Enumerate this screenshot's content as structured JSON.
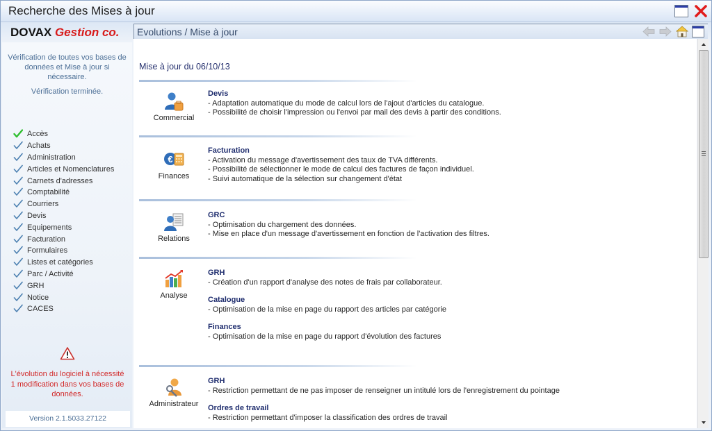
{
  "window": {
    "title": "Recherche des Mises à jour",
    "restore_icon": "window-restore-icon",
    "close_icon": "close-x-icon"
  },
  "brand": {
    "name": "DOVAX",
    "tagline": "Gestion co."
  },
  "header": {
    "breadcrumb": "Evolutions / Mise à jour",
    "icons": [
      "back-arrow-icon",
      "forward-arrow-icon",
      "home-icon",
      "window-icon"
    ]
  },
  "sidebar": {
    "info": "Vérification de toutes vos bases de données et Mise à jour si nécessaire.",
    "status": "Vérification terminée.",
    "checks": [
      {
        "label": "Accès",
        "state": "current",
        "color": "#2fbf2f"
      },
      {
        "label": "Achats",
        "state": "done",
        "color": "#4a7fb0"
      },
      {
        "label": "Administration",
        "state": "done",
        "color": "#4a7fb0"
      },
      {
        "label": "Articles et Nomenclatures",
        "state": "done",
        "color": "#4a7fb0"
      },
      {
        "label": "Carnets d'adresses",
        "state": "done",
        "color": "#4a7fb0"
      },
      {
        "label": "Comptabilité",
        "state": "done",
        "color": "#4a7fb0"
      },
      {
        "label": "Courriers",
        "state": "done",
        "color": "#4a7fb0"
      },
      {
        "label": "Devis",
        "state": "done",
        "color": "#4a7fb0"
      },
      {
        "label": "Equipements",
        "state": "done",
        "color": "#4a7fb0"
      },
      {
        "label": "Facturation",
        "state": "done",
        "color": "#4a7fb0"
      },
      {
        "label": "Formulaires",
        "state": "done",
        "color": "#4a7fb0"
      },
      {
        "label": "Listes et catégories",
        "state": "done",
        "color": "#4a7fb0"
      },
      {
        "label": "Parc / Activité",
        "state": "done",
        "color": "#4a7fb0"
      },
      {
        "label": "GRH",
        "state": "done",
        "color": "#4a7fb0"
      },
      {
        "label": "Notice",
        "state": "done",
        "color": "#4a7fb0"
      },
      {
        "label": "CACES",
        "state": "done",
        "color": "#4a7fb0"
      }
    ],
    "warning": "L'évolution du logiciel à nécessité 1 modification dans vos bases de données.",
    "version": "Version 2.1.5033.27122"
  },
  "content": {
    "update_date": "Mise à jour du 06/10/13",
    "modules": [
      {
        "label": "Commercial",
        "icon": "user-briefcase-icon",
        "entries": [
          {
            "title": "Devis",
            "lines": [
              "- Adaptation automatique du mode de calcul lors de l'ajout d'articles du catalogue.",
              "- Possibilité de choisir l'impression ou l'envoi par mail des devis à partir des conditions."
            ]
          }
        ]
      },
      {
        "label": "Finances",
        "icon": "euro-calculator-icon",
        "entries": [
          {
            "title": "Facturation",
            "lines": [
              "- Activation du message d'avertissement des taux de TVA différents.",
              "- Possibilité de sélectionner le mode de calcul des factures de façon individuel.",
              "- Suivi automatique de la sélection sur changement d'état"
            ]
          }
        ]
      },
      {
        "label": "Relations",
        "icon": "user-list-icon",
        "entries": [
          {
            "title": "GRC",
            "lines": [
              "- Optimisation du chargement des données.",
              "- Mise en place d'un message d'avertissement en fonction de l'activation des filtres."
            ]
          }
        ]
      },
      {
        "label": "Analyse",
        "icon": "bar-chart-icon",
        "entries": [
          {
            "title": "GRH",
            "lines": [
              "- Création d'un rapport d'analyse des notes de frais par collaborateur."
            ]
          },
          {
            "title": "Catalogue",
            "lines": [
              "- Optimisation de la mise en page du rapport des articles par catégorie"
            ]
          },
          {
            "title": "Finances",
            "lines": [
              "- Optimisation de la mise en page du rapport d'évolution des factures"
            ]
          }
        ]
      },
      {
        "label": "Administrateur",
        "icon": "user-key-icon",
        "entries": [
          {
            "title": "GRH",
            "lines": [
              "- Restriction permettant de ne pas imposer de renseigner un intitulé lors de l'enregistrement du pointage"
            ]
          },
          {
            "title": "Ordres de travail",
            "lines": [
              "- Restriction permettant d'imposer la classification des ordres de travail"
            ]
          }
        ]
      }
    ]
  }
}
